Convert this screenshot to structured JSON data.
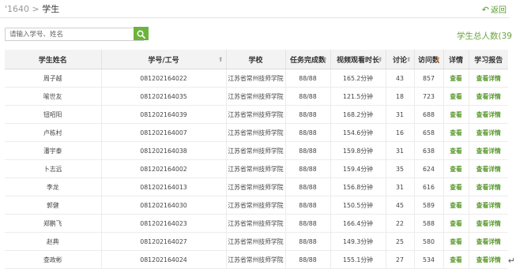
{
  "breadcrumb": {
    "prefix": "'1640 > ",
    "current": "学生"
  },
  "back_label": "返回",
  "search": {
    "placeholder": "请输入学号、姓名"
  },
  "total_label": "学生总人数(39",
  "columns": [
    {
      "label": "学生姓名",
      "sort": false
    },
    {
      "label": "学号/工号",
      "sort": true
    },
    {
      "label": "学校",
      "sort": false
    },
    {
      "label": "任务完成数",
      "sort": true
    },
    {
      "label": "视频观看时长",
      "sort": true
    },
    {
      "label": "讨论",
      "sort": true
    },
    {
      "label": "访问数",
      "sort": true,
      "active": true
    },
    {
      "label": "详情",
      "sort": false
    },
    {
      "label": "学习报告",
      "sort": false
    }
  ],
  "rows": [
    {
      "name": "周子越",
      "id": "081202164022",
      "school": "江苏省常州技师学院",
      "tasks": "88/88",
      "video": "165.2分钟",
      "discuss": "43",
      "visits": "857",
      "detail": "查看",
      "report": "查看详情"
    },
    {
      "name": "喻世友",
      "id": "081202164035",
      "school": "江苏省常州技师学院",
      "tasks": "88/88",
      "video": "121.5分钟",
      "discuss": "18",
      "visits": "723",
      "detail": "查看",
      "report": "查看详情"
    },
    {
      "name": "钮昭阳",
      "id": "081202164039",
      "school": "江苏省常州技师学院",
      "tasks": "88/88",
      "video": "168.2分钟",
      "discuss": "31",
      "visits": "688",
      "detail": "查看",
      "report": "查看详情"
    },
    {
      "name": "卢栋村",
      "id": "081202164007",
      "school": "江苏省常州技师学院",
      "tasks": "88/88",
      "video": "154.6分钟",
      "discuss": "16",
      "visits": "658",
      "detail": "查看",
      "report": "查看详情"
    },
    {
      "name": "潘宇泰",
      "id": "081202164038",
      "school": "江苏省常州技师学院",
      "tasks": "88/88",
      "video": "159.8分钟",
      "discuss": "31",
      "visits": "638",
      "detail": "查看",
      "report": "查看详情"
    },
    {
      "name": "卜志远",
      "id": "081202164002",
      "school": "江苏省常州技师学院",
      "tasks": "88/88",
      "video": "159.4分钟",
      "discuss": "35",
      "visits": "624",
      "detail": "查看",
      "report": "查看详情"
    },
    {
      "name": "李龙",
      "id": "081202164013",
      "school": "江苏省常州技师学院",
      "tasks": "88/88",
      "video": "156.8分钟",
      "discuss": "31",
      "visits": "616",
      "detail": "查看",
      "report": "查看详情"
    },
    {
      "name": "郭健",
      "id": "081202164030",
      "school": "江苏省常州技师学院",
      "tasks": "88/88",
      "video": "150.5分钟",
      "discuss": "45",
      "visits": "589",
      "detail": "查看",
      "report": "查看详情"
    },
    {
      "name": "郑鹏飞",
      "id": "081202164023",
      "school": "江苏省常州技师学院",
      "tasks": "88/88",
      "video": "166.4分钟",
      "discuss": "22",
      "visits": "588",
      "detail": "查看",
      "report": "查看详情"
    },
    {
      "name": "赵典",
      "id": "081202164027",
      "school": "江苏省常州技师学院",
      "tasks": "88/88",
      "video": "149.3分钟",
      "discuss": "25",
      "visits": "580",
      "detail": "查看",
      "report": "查看详情"
    },
    {
      "name": "查政彬",
      "id": "081202164024",
      "school": "江苏省常州技师学院",
      "tasks": "88/88",
      "video": "155.1分钟",
      "discuss": "27",
      "visits": "534",
      "detail": "查看",
      "report": "查看详情"
    }
  ],
  "colors": {
    "accent": "#6cb33e",
    "link": "#5a9a2e",
    "sort_active": "#e8812f"
  }
}
